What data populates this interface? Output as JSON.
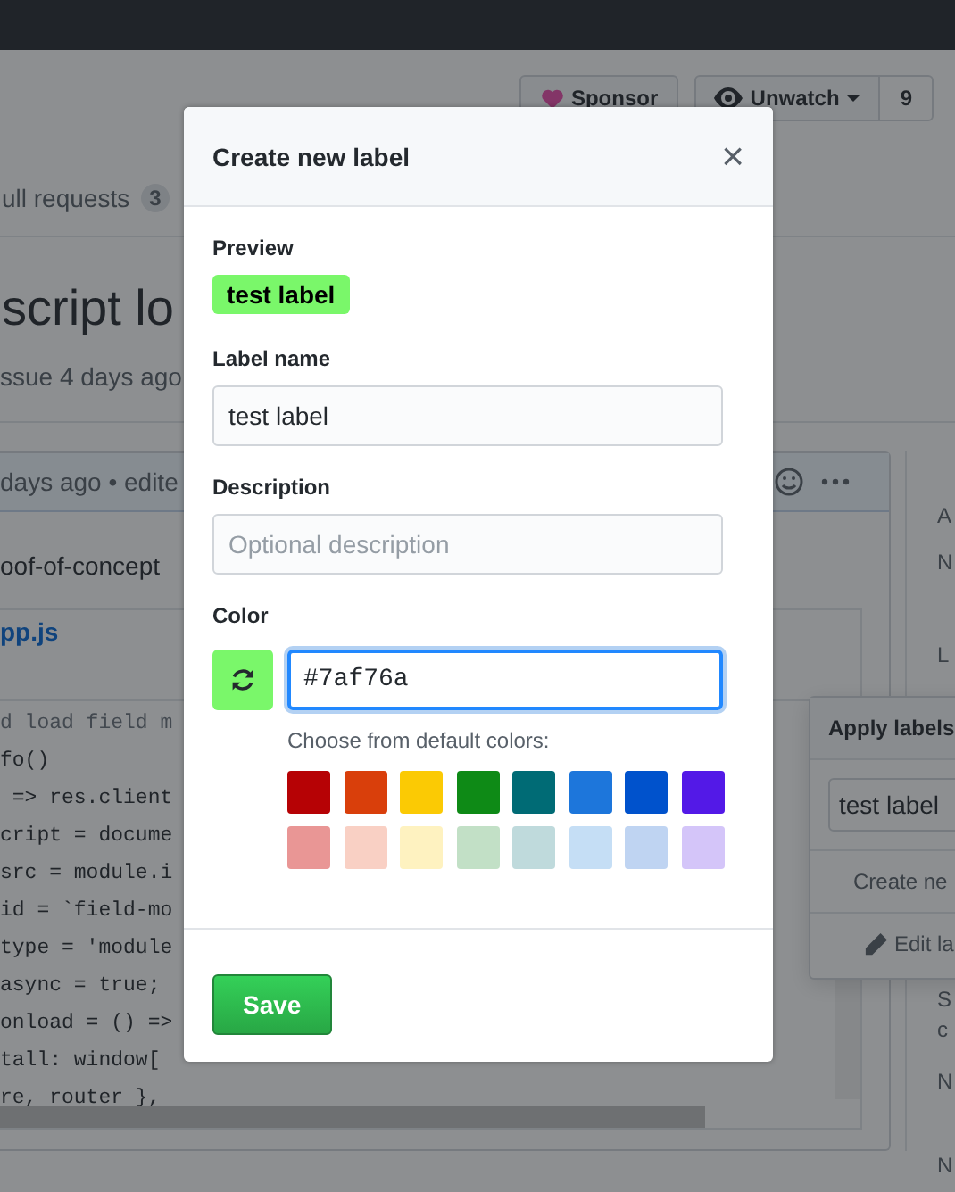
{
  "repo_actions": {
    "sponsor": "Sponsor",
    "watch": "Unwatch",
    "watch_count": "9"
  },
  "tabs": [
    {
      "label": "ull requests",
      "count": "3"
    }
  ],
  "issue": {
    "title": "script lo",
    "meta": "ssue 4 days ago"
  },
  "comment": {
    "header": "days ago • edite",
    "body": "oof-of-concept",
    "file": "pp.js",
    "code": [
      "d load field m",
      "fo()",
      " => res.client",
      "cript = docume",
      "src = module.i",
      "id = `field-mo",
      "type = 'module",
      "async = true;",
      "onload = () =>",
      "tall: window[",
      "re, router },"
    ]
  },
  "sidebar_fragments": [
    "A",
    "N",
    "L",
    "S",
    "c",
    "N",
    "N"
  ],
  "apply_labels": {
    "title": "Apply labels",
    "filter_value": "test label",
    "create": "Create ne",
    "edit": "Edit la"
  },
  "dialog": {
    "title": "Create new label",
    "close": "×",
    "preview_label": "Preview",
    "preview": "test label",
    "name_label": "Label name",
    "name_value": "test label",
    "description_label": "Description",
    "description_placeholder": "Optional description",
    "color_label": "Color",
    "color_value": "#7af76a",
    "swatches_label": "Choose from default colors:",
    "swatches": [
      {
        "color": "#b60205"
      },
      {
        "color": "#d93f0b"
      },
      {
        "color": "#fbca04"
      },
      {
        "color": "#0e8a16"
      },
      {
        "color": "#006b75"
      },
      {
        "color": "#1d76db"
      },
      {
        "color": "#0052cc"
      },
      {
        "color": "#5319e7"
      },
      {
        "color": "#e99695"
      },
      {
        "color": "#f9d0c4"
      },
      {
        "color": "#fef2c0"
      },
      {
        "color": "#c2e0c6"
      },
      {
        "color": "#bfdadc"
      },
      {
        "color": "#c5def5"
      },
      {
        "color": "#bfd4f2"
      },
      {
        "color": "#d4c5f9"
      }
    ],
    "save": "Save"
  }
}
